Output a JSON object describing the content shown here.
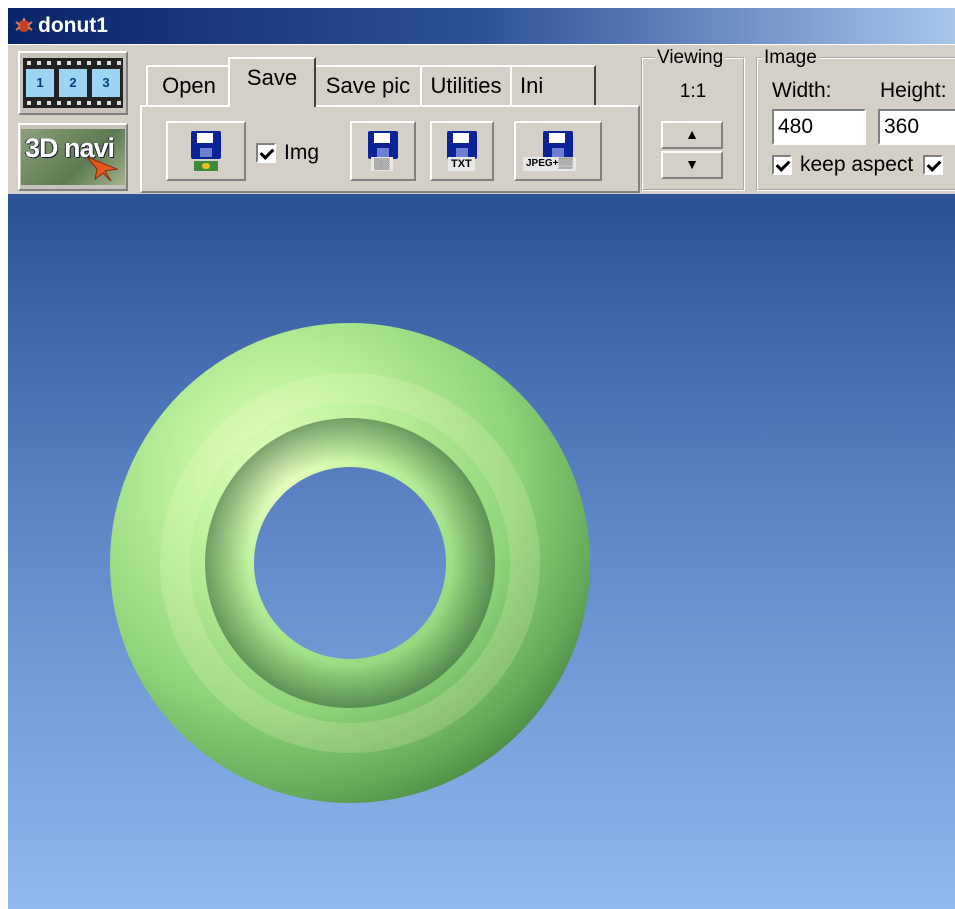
{
  "window": {
    "title": "donut1"
  },
  "left_buttons": {
    "film_frames": [
      "1",
      "2",
      "3"
    ],
    "navi_label": "3D navi"
  },
  "tabs": [
    {
      "label": "Open",
      "active": false
    },
    {
      "label": "Save",
      "active": true
    },
    {
      "label": "Save pic",
      "active": false
    },
    {
      "label": "Utilities",
      "active": false
    },
    {
      "label": "Ini",
      "active": false
    }
  ],
  "save_panel": {
    "img_checkbox": {
      "label": "Img",
      "checked": true
    },
    "icons": [
      "save-image-icon",
      "save-icon",
      "save-txt-icon",
      "save-jpeg-icon"
    ],
    "txt_badge": "TXT",
    "jpeg_badge": "JPEG+"
  },
  "viewing": {
    "label": "Viewing",
    "ratio": "1:1",
    "up_arrow": "▲",
    "down_arrow": "▼"
  },
  "image": {
    "label": "Image",
    "width_label": "Width:",
    "height_label": "Height:",
    "width_value": "480",
    "height_value": "360",
    "keep_aspect_label": "keep aspect",
    "keep_aspect_checked": true
  },
  "scene": {
    "object": "torus",
    "object_color": "#9ee68a",
    "background_top": "#2a5196",
    "background_bottom": "#90b8ee"
  }
}
